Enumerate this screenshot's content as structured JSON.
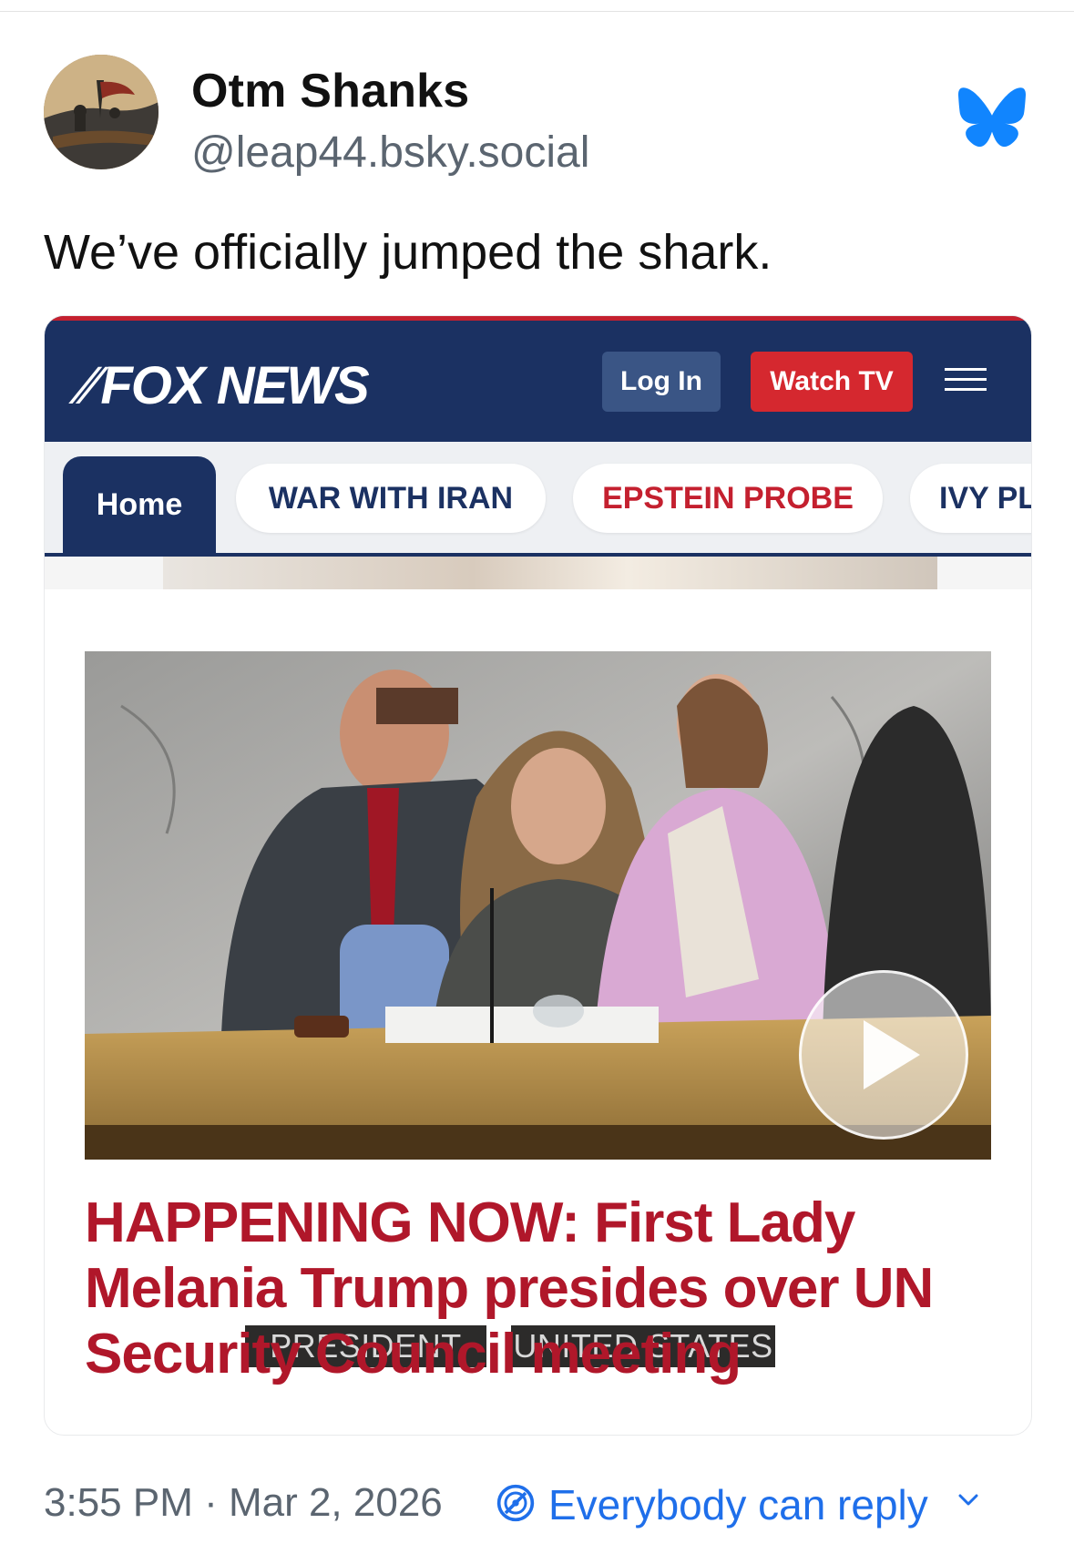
{
  "post": {
    "author_name": "Otm Shanks",
    "author_handle": "@leap44.bsky.social",
    "text": "We’ve officially jumped the shark.",
    "timestamp": "3:55 PM · Mar 2, 2026",
    "reply_setting": "Everybody can reply"
  },
  "embed": {
    "site": {
      "logo_text": "FOX NEWS",
      "login_label": "Log In",
      "watch_label": "Watch TV"
    },
    "tabs": [
      {
        "label": "Home"
      },
      {
        "label": "WAR WITH IRAN"
      },
      {
        "label": "EPSTEIN PROBE"
      },
      {
        "label": "IVY PL"
      }
    ],
    "photo": {
      "plaque_left": "PRESIDENT",
      "plaque_right": "UNITED STATES"
    },
    "headline": "HAPPENING NOW: First Lady Melania Trump presides over UN Security Council meeting"
  },
  "colors": {
    "fox_navy": "#1b3162",
    "fox_red": "#c4202f",
    "bluesky_blue": "#1f6fea"
  },
  "icons": [
    "bluesky-butterfly-icon",
    "hamburger-menu-icon",
    "play-icon",
    "reply-settings-icon",
    "chevron-down-icon"
  ]
}
